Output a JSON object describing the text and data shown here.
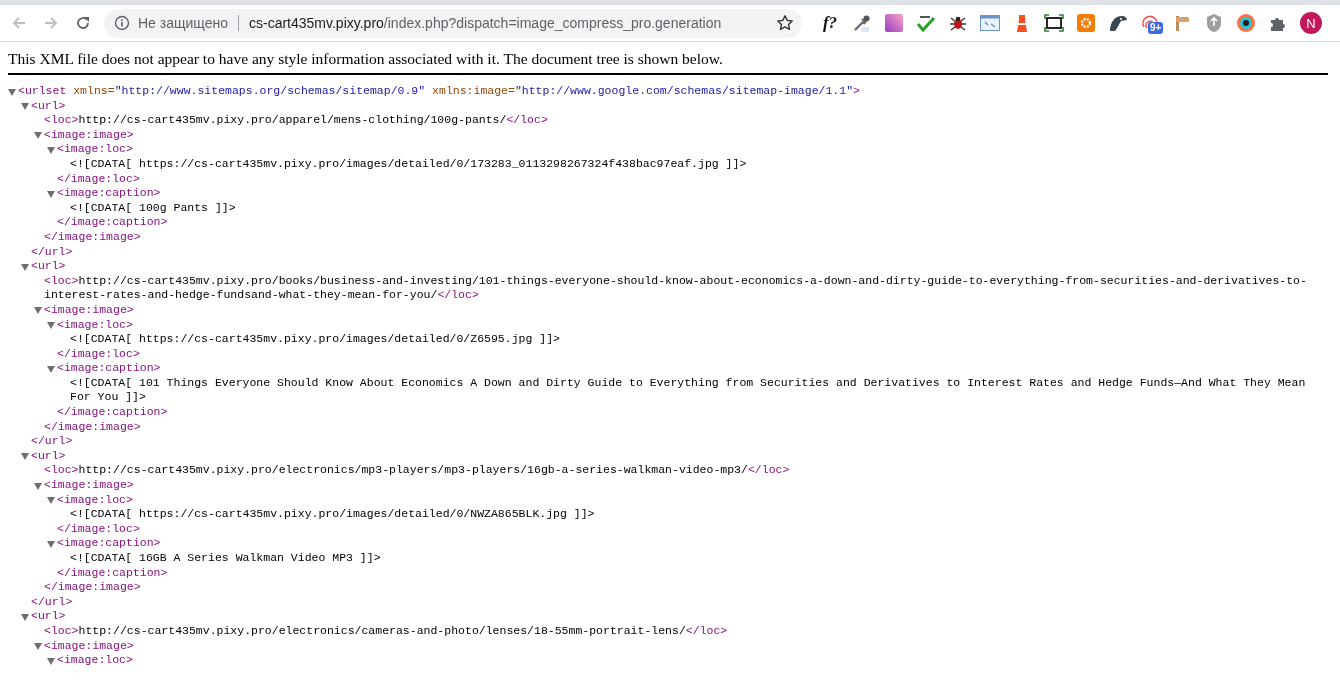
{
  "browser": {
    "back_disabled": true,
    "forward_disabled": true,
    "security_label": "Не защищено",
    "url_host": "cs-cart435mv.pixy.pro",
    "url_path": "/index.php?dispatch=image_compress_pro.generation",
    "bookmarked": false,
    "extensions": [
      {
        "kind": "formula",
        "label": "f?"
      },
      {
        "kind": "eyedropper"
      },
      {
        "kind": "gradient"
      },
      {
        "kind": "spellcheck"
      },
      {
        "kind": "bug"
      },
      {
        "kind": "window"
      },
      {
        "kind": "lighthouse"
      },
      {
        "kind": "capture"
      },
      {
        "kind": "gear"
      },
      {
        "kind": "bird"
      },
      {
        "kind": "fingerprint",
        "badge": "9+"
      },
      {
        "kind": "signpost"
      },
      {
        "kind": "shield"
      },
      {
        "kind": "eye"
      },
      {
        "kind": "puzzle"
      }
    ],
    "profile_initial": "N"
  },
  "notice": "This XML file does not appear to have any style information associated with it. The document tree is shown below.",
  "xml_tree": {
    "kind": "element",
    "open_tag": "<urlset",
    "attributes": [
      {
        "name": "xmlns=",
        "value": "\"http://www.sitemaps.org/schemas/sitemap/0.9\""
      },
      {
        "name": "xmlns:image=",
        "value": "\"http://www.google.com/schemas/sitemap-image/1.1\""
      }
    ],
    "open_tag_end": ">",
    "expanded": true,
    "children": [
      {
        "kind": "element",
        "open_tag": "<url>",
        "expanded": true,
        "children": [
          {
            "kind": "leaf",
            "open_tag": "<loc>",
            "text": "http://cs-cart435mv.pixy.pro/apparel/mens-clothing/100g-pants/",
            "close_tag": "</loc>"
          },
          {
            "kind": "element",
            "open_tag": "<image:image>",
            "expanded": true,
            "children": [
              {
                "kind": "element",
                "open_tag": "<image:loc>",
                "expanded": true,
                "children": [
                  {
                    "kind": "cdata",
                    "text": "<![CDATA[ https://cs-cart435mv.pixy.pro/images/detailed/0/173283_0113298267324f438bac97eaf.jpg ]]>"
                  }
                ],
                "close_tag": "</image:loc>"
              },
              {
                "kind": "element",
                "open_tag": "<image:caption>",
                "expanded": true,
                "children": [
                  {
                    "kind": "cdata",
                    "text": "<![CDATA[ 100g Pants ]]>"
                  }
                ],
                "close_tag": "</image:caption>"
              }
            ],
            "close_tag": "</image:image>"
          }
        ],
        "close_tag": "</url>"
      },
      {
        "kind": "element",
        "open_tag": "<url>",
        "expanded": true,
        "children": [
          {
            "kind": "leaf",
            "open_tag": "<loc>",
            "text": "http://cs-cart435mv.pixy.pro/books/business-and-investing/101-things-everyone-should-know-about-economics-a-down-and-dirty-guide-to-everything-from-securities-and-derivatives-to-interest-rates-and-hedge-fundsand-what-they-mean-for-you/",
            "close_tag": "</loc>"
          },
          {
            "kind": "element",
            "open_tag": "<image:image>",
            "expanded": true,
            "children": [
              {
                "kind": "element",
                "open_tag": "<image:loc>",
                "expanded": true,
                "children": [
                  {
                    "kind": "cdata",
                    "text": "<![CDATA[ https://cs-cart435mv.pixy.pro/images/detailed/0/Z6595.jpg ]]>"
                  }
                ],
                "close_tag": "</image:loc>"
              },
              {
                "kind": "element",
                "open_tag": "<image:caption>",
                "expanded": true,
                "children": [
                  {
                    "kind": "cdata",
                    "text": "<![CDATA[ 101 Things Everyone Should Know About Economics A Down and Dirty Guide to Everything from Securities and Derivatives to Interest Rates and Hedge Funds—And What They Mean For You ]]>"
                  }
                ],
                "close_tag": "</image:caption>"
              }
            ],
            "close_tag": "</image:image>"
          }
        ],
        "close_tag": "</url>"
      },
      {
        "kind": "element",
        "open_tag": "<url>",
        "expanded": true,
        "children": [
          {
            "kind": "leaf",
            "open_tag": "<loc>",
            "text": "http://cs-cart435mv.pixy.pro/electronics/mp3-players/mp3-players/16gb-a-series-walkman-video-mp3/",
            "close_tag": "</loc>"
          },
          {
            "kind": "element",
            "open_tag": "<image:image>",
            "expanded": true,
            "children": [
              {
                "kind": "element",
                "open_tag": "<image:loc>",
                "expanded": true,
                "children": [
                  {
                    "kind": "cdata",
                    "text": "<![CDATA[ https://cs-cart435mv.pixy.pro/images/detailed/0/NWZA865BLK.jpg ]]>"
                  }
                ],
                "close_tag": "</image:loc>"
              },
              {
                "kind": "element",
                "open_tag": "<image:caption>",
                "expanded": true,
                "children": [
                  {
                    "kind": "cdata",
                    "text": "<![CDATA[ 16GB A Series Walkman Video MP3 ]]>"
                  }
                ],
                "close_tag": "</image:caption>"
              }
            ],
            "close_tag": "</image:image>"
          }
        ],
        "close_tag": "</url>"
      },
      {
        "kind": "element",
        "open_tag": "<url>",
        "expanded": true,
        "children": [
          {
            "kind": "leaf",
            "open_tag": "<loc>",
            "text": "http://cs-cart435mv.pixy.pro/electronics/cameras-and-photo/lenses/18-55mm-portrait-lens/",
            "close_tag": "</loc>"
          },
          {
            "kind": "element",
            "open_tag": "<image:image>",
            "expanded": true,
            "children": [
              {
                "kind": "element",
                "open_tag": "<image:loc>",
                "expanded": true
              }
            ]
          }
        ]
      }
    ]
  }
}
